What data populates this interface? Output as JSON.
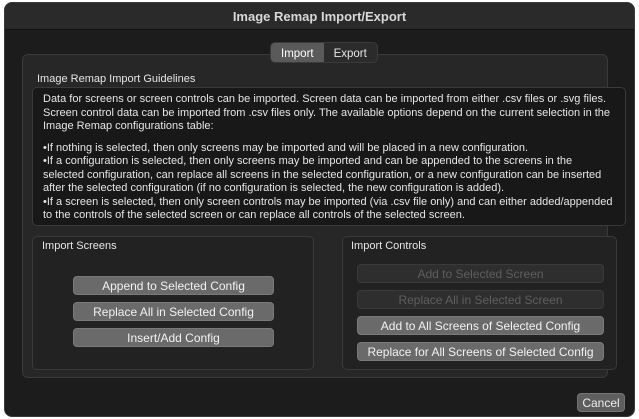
{
  "window": {
    "title": "Image Remap Import/Export"
  },
  "tabs": [
    {
      "label": "Import",
      "active": true
    },
    {
      "label": "Export",
      "active": false
    }
  ],
  "guidelines": {
    "heading": "Image Remap Import Guidelines",
    "intro": "Data for screens or screen controls can be imported. Screen data can be imported from either .csv files or .svg files. Screen control data can be imported from .csv files only. The available options depend on the current selection in the Image Remap configurations table:",
    "bullets": [
      "If nothing is selected, then only screens may be imported and will be placed in a new configuration.",
      "If a configuration is selected, then only screens may be imported and can be appended to the screens in the selected configuration, can replace all screens in the selected configuration, or a new configuration can be inserted after the selected configuration (if no configuration is selected, the new configuration is added).",
      "If a screen is selected, then only screen controls may be imported (via .csv file only) and can either added/appended to the controls of the selected screen or can replace all controls of the selected screen."
    ]
  },
  "import_screens": {
    "heading": "Import Screens",
    "buttons": {
      "append": "Append to Selected Config",
      "replace_all": "Replace All in Selected Config",
      "insert_add": "Insert/Add Config"
    }
  },
  "import_controls": {
    "heading": "Import Controls",
    "buttons": {
      "add_selected_screen": "Add to Selected Screen",
      "replace_all_selected_screen": "Replace All in Selected Screen",
      "add_all_screens": "Add to All Screens of Selected Config",
      "replace_all_screens": "Replace for All Screens of Selected Config"
    }
  },
  "footer": {
    "cancel_label": "Cancel"
  },
  "colors": {
    "window_bg": "#1c1c1c",
    "button_bg": "#6a6a6a",
    "disabled_text": "#5e5e5e"
  }
}
